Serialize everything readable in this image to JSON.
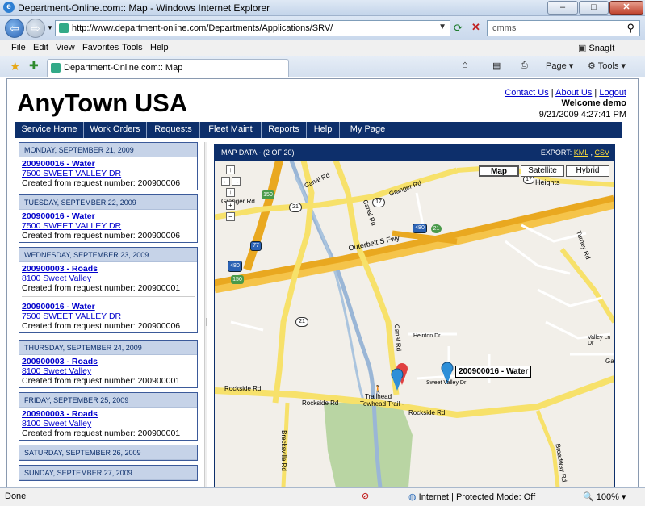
{
  "window": {
    "title": "Department-Online.com:: Map - Windows Internet Explorer"
  },
  "address": {
    "url": "http://www.department-online.com/Departments/Applications/SRV/",
    "search": "cmms"
  },
  "menu": [
    "File",
    "Edit",
    "View",
    "Favorites",
    "Tools",
    "Help"
  ],
  "toolbar": {
    "snagit": "SnagIt",
    "page": "Page",
    "tools": "Tools"
  },
  "tab": {
    "label": "Department-Online.com:: Map"
  },
  "site": {
    "logo": "AnyTown USA",
    "links": [
      "Contact Us",
      "About Us",
      "Logout"
    ],
    "welcome": "Welcome demo",
    "datetime": "9/21/2009 4:27:41 PM",
    "nav": [
      "Service Home",
      "Work Orders",
      "Requests",
      "Fleet Maint",
      "Reports",
      "Help",
      "My Page"
    ]
  },
  "days": [
    {
      "header": "MONDAY, SEPTEMBER 21, 2009",
      "entries": [
        {
          "title": "200900016 - Water",
          "addr": "7500 SWEET VALLEY DR",
          "created": "Created from request number: 200900006"
        }
      ]
    },
    {
      "header": "TUESDAY, SEPTEMBER 22, 2009",
      "entries": [
        {
          "title": "200900016 - Water",
          "addr": "7500 SWEET VALLEY DR",
          "created": "Created from request number: 200900006"
        }
      ]
    },
    {
      "header": "WEDNESDAY, SEPTEMBER 23, 2009",
      "entries": [
        {
          "title": "200900003 - Roads",
          "addr": "8100 Sweet Valley",
          "created": "Created from request number: 200900001"
        },
        {
          "title": "200900016 - Water",
          "addr": "7500 SWEET VALLEY DR",
          "created": "Created from request number: 200900006"
        }
      ]
    },
    {
      "header": "THURSDAY, SEPTEMBER 24, 2009",
      "entries": [
        {
          "title": "200900003 - Roads",
          "addr": "8100 Sweet Valley",
          "created": "Created from request number: 200900001"
        }
      ]
    },
    {
      "header": "FRIDAY, SEPTEMBER 25, 2009",
      "entries": [
        {
          "title": "200900003 - Roads",
          "addr": "8100 Sweet Valley",
          "created": "Created from request number: 200900001"
        }
      ]
    },
    {
      "header": "SATURDAY, SEPTEMBER 26, 2009",
      "entries": []
    },
    {
      "header": "SUNDAY, SEPTEMBER 27, 2009",
      "entries": []
    }
  ],
  "map": {
    "header": "MAP DATA - (2 OF 20)",
    "export_label": "EXPORT:",
    "export_links": [
      "KML",
      "CSV"
    ],
    "types": [
      "Map",
      "Satellite",
      "Hybrid"
    ],
    "pin_label": "200900016 - Water",
    "labels": {
      "canal_rd_top": "Canal Rd",
      "granger": "Granger Rd",
      "granger2": "Granger Rd",
      "heights": "Heights",
      "outerbelt": "Outerbelt S Fwy",
      "canal_rd_mid": "Canal Rd",
      "canal_rd_low": "Canal Rd",
      "rockside_l": "Rockside Rd",
      "rockside_m": "Rockside Rd",
      "rockside_r": "Rockside Rd",
      "heinton": "Heinton Dr",
      "sweetvalley": "Sweet Valley Dr",
      "trailhead": "Trailhead",
      "towhead": "Towhead Trail -",
      "brecksville": "Brecksville Rd",
      "turney": "Turney Rd",
      "valleyln": "Valley Ln Dr",
      "ga": "Ga",
      "broadway": "Broadway Rd",
      "h17a": "17",
      "h17b": "17",
      "h21a": "21",
      "h21b": "21",
      "h480a": "480",
      "h480b": "480",
      "h77": "77",
      "h150a": "150",
      "h150b": "150",
      "h21g": "21"
    }
  },
  "status": {
    "text": "Done",
    "zone": "Internet | Protected Mode: Off",
    "zoom": "100%"
  }
}
